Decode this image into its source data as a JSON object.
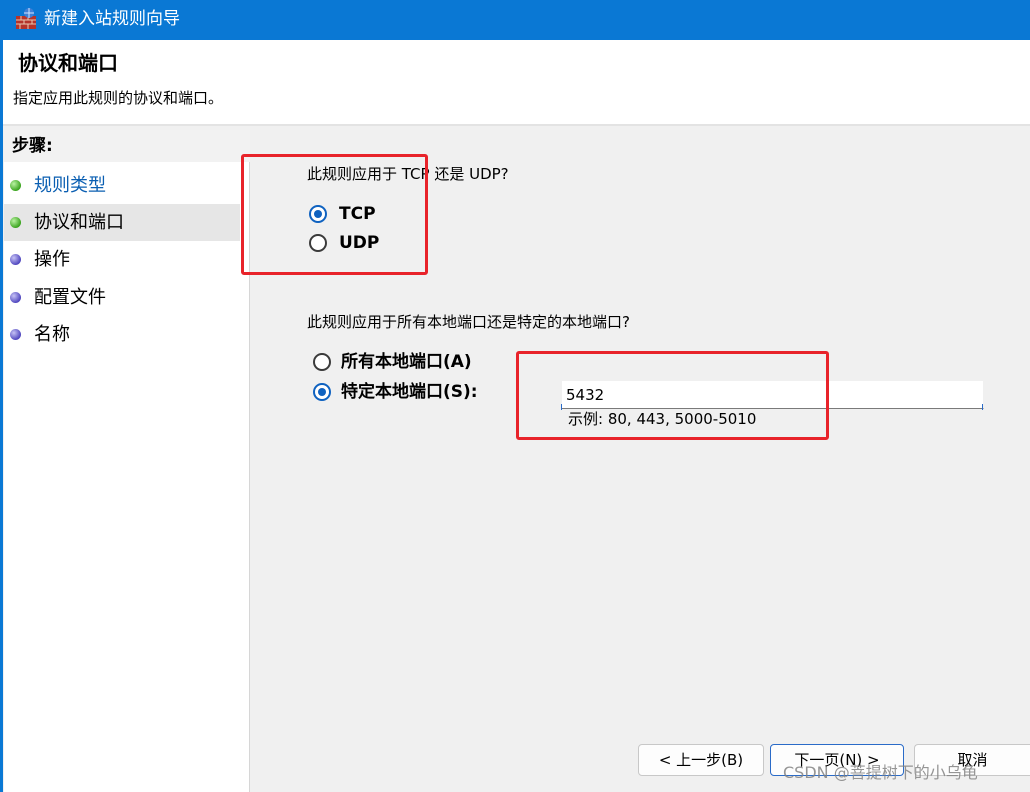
{
  "window": {
    "title": "新建入站规则向导"
  },
  "header": {
    "title": "协议和端口",
    "description": "指定应用此规则的协议和端口。"
  },
  "sidebar": {
    "heading": "步骤:",
    "steps": [
      {
        "label": "规则类型",
        "status": "completed",
        "dot_color": "#3ba41f"
      },
      {
        "label": "协议和端口",
        "status": "current",
        "dot_color": "#3ba41f"
      },
      {
        "label": "操作",
        "status": "pending",
        "dot_color": "#5148bf"
      },
      {
        "label": "配置文件",
        "status": "pending",
        "dot_color": "#5148bf"
      },
      {
        "label": "名称",
        "status": "pending",
        "dot_color": "#5148bf"
      }
    ]
  },
  "protocol": {
    "question": "此规则应用于 TCP 还是 UDP?",
    "options": [
      {
        "label": "TCP",
        "checked": true
      },
      {
        "label": "UDP",
        "checked": false
      }
    ]
  },
  "ports": {
    "question": "此规则应用于所有本地端口还是特定的本地端口?",
    "options": [
      {
        "label": "所有本地端口(A)",
        "checked": false
      },
      {
        "label": "特定本地端口(S):",
        "checked": true
      }
    ],
    "value": "5432",
    "example": "示例: 80, 443, 5000-5010"
  },
  "buttons": {
    "back": "< 上一步(B)",
    "next": "下一页(N) >",
    "cancel": "取消"
  },
  "watermark": "CSDN @菩提树下的小乌龟",
  "colors": {
    "title_bar": "#0a78d4",
    "radio_checked": "#0f62c0",
    "annotation_red": "#e8232a",
    "link_blue": "#0b5fb2"
  }
}
